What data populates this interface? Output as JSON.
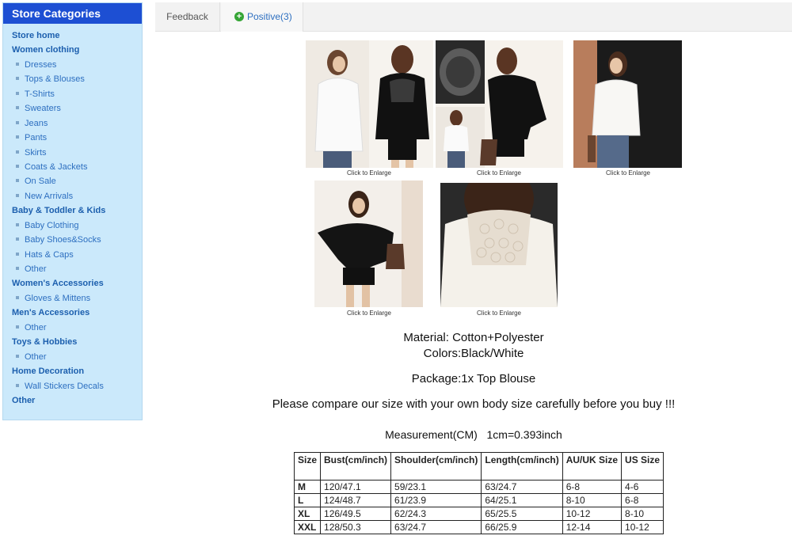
{
  "sidebar": {
    "title": "Store Categories",
    "items": [
      {
        "label": "Store home",
        "type": "cat"
      },
      {
        "label": "Women clothing",
        "type": "cat"
      },
      {
        "label": "Dresses",
        "type": "sub"
      },
      {
        "label": "Tops & Blouses",
        "type": "sub"
      },
      {
        "label": "T-Shirts",
        "type": "sub"
      },
      {
        "label": "Sweaters",
        "type": "sub"
      },
      {
        "label": "Jeans",
        "type": "sub"
      },
      {
        "label": "Pants",
        "type": "sub"
      },
      {
        "label": "Skirts",
        "type": "sub"
      },
      {
        "label": "Coats & Jackets",
        "type": "sub"
      },
      {
        "label": "On Sale",
        "type": "sub"
      },
      {
        "label": "New Arrivals",
        "type": "sub"
      },
      {
        "label": "Baby & Toddler & Kids",
        "type": "cat"
      },
      {
        "label": "Baby Clothing",
        "type": "sub"
      },
      {
        "label": "Baby Shoes&Socks",
        "type": "sub"
      },
      {
        "label": "Hats & Caps",
        "type": "sub"
      },
      {
        "label": "Other",
        "type": "sub"
      },
      {
        "label": "Women's Accessories",
        "type": "cat"
      },
      {
        "label": "Gloves & Mittens",
        "type": "sub"
      },
      {
        "label": "Men's Accessories",
        "type": "cat"
      },
      {
        "label": "Other",
        "type": "sub"
      },
      {
        "label": "Toys & Hobbies",
        "type": "cat"
      },
      {
        "label": "Other",
        "type": "sub"
      },
      {
        "label": "Home Decoration",
        "type": "cat"
      },
      {
        "label": "Wall Stickers Decals",
        "type": "sub"
      },
      {
        "label": "Other",
        "type": "cat"
      }
    ]
  },
  "tabs": {
    "feedback": "Feedback",
    "positive": "Positive(3)"
  },
  "colors": {
    "sidebar_bg": "#cbe9fb",
    "sidebar_header": "#1d4fd3",
    "link": "#2d6fc0",
    "positive_icon": "#35a535"
  },
  "photos": {
    "caption": "Click to Enlarge"
  },
  "description": {
    "material": "Material: Cotton+Polyester",
    "colors": "Colors:Black/White",
    "package": "Package:1x Top Blouse",
    "notice": "Please compare our size with your own body size carefully before you buy !!!",
    "measurement": "Measurement(CM)   1cm=0.393inch"
  },
  "size_table": {
    "headers": [
      "Size",
      "Bust(cm/inch)",
      "Shoulder(cm/inch)",
      "Length(cm/inch)",
      "AU/UK Size",
      "US Size"
    ],
    "rows": [
      [
        "M",
        "120/47.1",
        "59/23.1",
        "63/24.7",
        "6-8",
        "4-6"
      ],
      [
        "L",
        "124/48.7",
        "61/23.9",
        "64/25.1",
        "8-10",
        "6-8"
      ],
      [
        "XL",
        "126/49.5",
        "62/24.3",
        "65/25.5",
        "10-12",
        "8-10"
      ],
      [
        "XXL",
        "128/50.3",
        "63/24.7",
        "66/25.9",
        "12-14",
        "10-12"
      ]
    ]
  }
}
